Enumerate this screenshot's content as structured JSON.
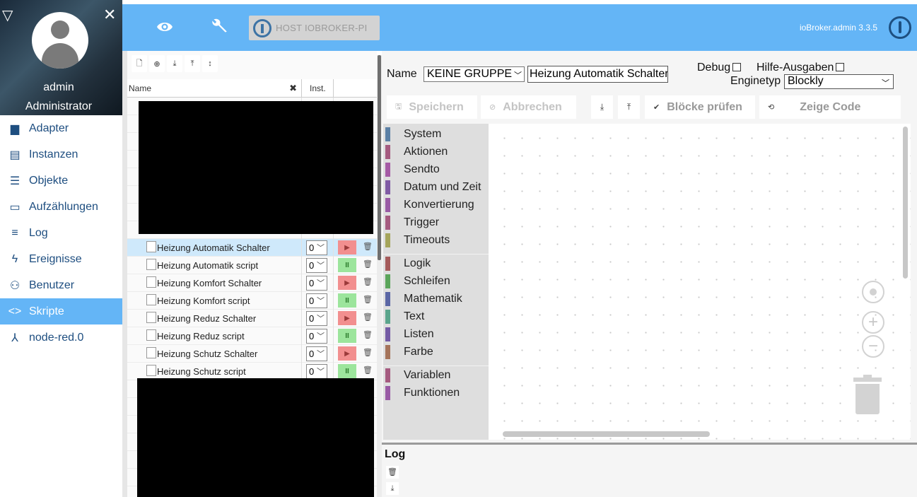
{
  "sidebar": {
    "user_name": "admin",
    "user_role": "Administrator",
    "items": [
      {
        "label": "Adapter",
        "icon": "store-icon",
        "glyph": "▆"
      },
      {
        "label": "Instanzen",
        "icon": "instances-icon",
        "glyph": "▤"
      },
      {
        "label": "Objekte",
        "icon": "list-icon",
        "glyph": "☰"
      },
      {
        "label": "Aufzählungen",
        "icon": "enum-icon",
        "glyph": "▭"
      },
      {
        "label": "Log",
        "icon": "log-icon",
        "glyph": "≡"
      },
      {
        "label": "Ereignisse",
        "icon": "lightning-icon",
        "glyph": "ϟ"
      },
      {
        "label": "Benutzer",
        "icon": "user-icon",
        "glyph": "⚇"
      },
      {
        "label": "Skripte",
        "icon": "code-icon",
        "glyph": "<>"
      },
      {
        "label": "node-red.0",
        "icon": "node-red-icon",
        "glyph": "⅄"
      }
    ],
    "active_index": 7
  },
  "topbar": {
    "host_label": "HOST IOBROKER-PI",
    "version": "ioBroker.admin 3.3.5"
  },
  "scripts": {
    "col_name": "Name",
    "col_inst": "Inst.",
    "rows": [
      {
        "name": "Heizung Automatik Schalter",
        "inst": "0",
        "state": "stopped",
        "selected": true
      },
      {
        "name": "Heizung Automatik script",
        "inst": "0",
        "state": "running",
        "selected": false
      },
      {
        "name": "Heizung Komfort Schalter",
        "inst": "0",
        "state": "stopped",
        "selected": false
      },
      {
        "name": "Heizung Komfort script",
        "inst": "0",
        "state": "running",
        "selected": false
      },
      {
        "name": "Heizung Reduz Schalter",
        "inst": "0",
        "state": "stopped",
        "selected": false
      },
      {
        "name": "Heizung Reduz script",
        "inst": "0",
        "state": "running",
        "selected": false
      },
      {
        "name": "Heizung Schutz Schalter",
        "inst": "0",
        "state": "stopped",
        "selected": false
      },
      {
        "name": "Heizung Schutz script",
        "inst": "0",
        "state": "running",
        "selected": false
      }
    ]
  },
  "editor": {
    "name_label": "Name",
    "group_value": "KEINE GRUPPE",
    "script_name": "Heizung Automatik Schalter",
    "debug_label": "Debug",
    "help_label": "Hilfe-Ausgaben",
    "engine_label": "Enginetyp",
    "engine_value": "Blockly",
    "save_label": "Speichern",
    "cancel_label": "Abbrechen",
    "check_label": "Blöcke prüfen",
    "code_label": "Zeige Code",
    "log_label": "Log"
  },
  "toolbox": {
    "groups": [
      [
        {
          "label": "System",
          "color": "#5b80a5"
        },
        {
          "label": "Aktionen",
          "color": "#a55b80"
        },
        {
          "label": "Sendto",
          "color": "#a55ba5"
        },
        {
          "label": "Datum und Zeit",
          "color": "#805ba5"
        },
        {
          "label": "Konvertierung",
          "color": "#995ba5"
        },
        {
          "label": "Trigger",
          "color": "#a55b80"
        },
        {
          "label": "Timeouts",
          "color": "#a5a55b"
        }
      ],
      [
        {
          "label": "Logik",
          "color": "#a55b5b"
        },
        {
          "label": "Schleifen",
          "color": "#5ba55b"
        },
        {
          "label": "Mathematik",
          "color": "#5b67a5"
        },
        {
          "label": "Text",
          "color": "#5ba58c"
        },
        {
          "label": "Listen",
          "color": "#745ba5"
        },
        {
          "label": "Farbe",
          "color": "#a5745b"
        }
      ],
      [
        {
          "label": "Variablen",
          "color": "#a55b80"
        },
        {
          "label": "Funktionen",
          "color": "#995ba5"
        }
      ]
    ]
  }
}
